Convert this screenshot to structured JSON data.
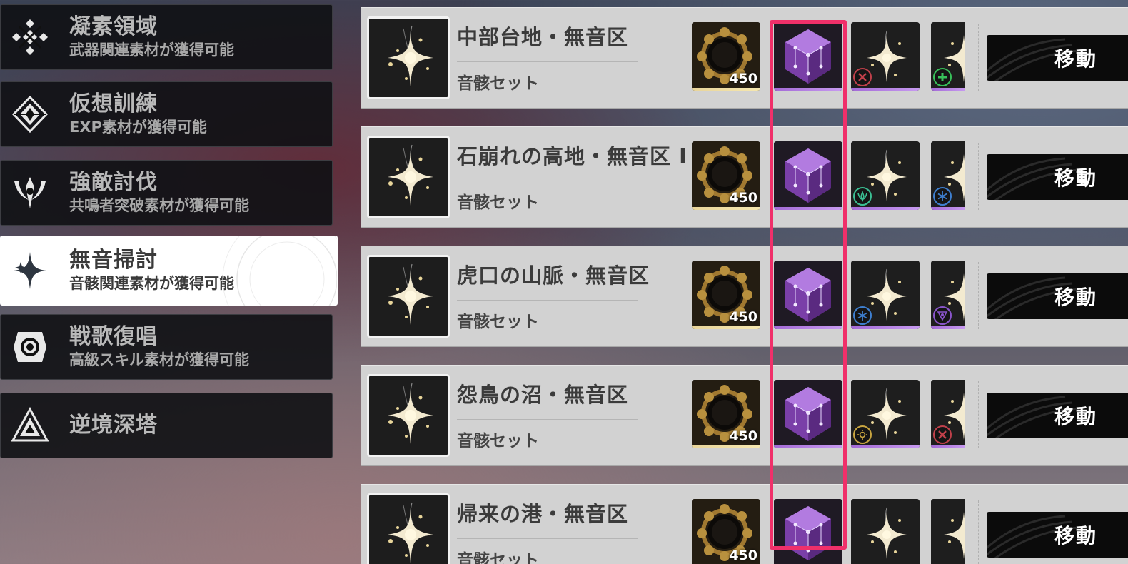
{
  "sidebar": {
    "items": [
      {
        "title": "凝素領域",
        "subtitle": "武器関連素材が獲得可能",
        "icon": "weapon-domain-icon",
        "active": false
      },
      {
        "title": "仮想訓練",
        "subtitle": "EXP素材が獲得可能",
        "icon": "simulation-training-icon",
        "active": false
      },
      {
        "title": "強敵討伐",
        "subtitle": "共鳴者突破素材が獲得可能",
        "icon": "boss-challenge-icon",
        "active": false
      },
      {
        "title": "無音掃討",
        "subtitle": "音骸関連素材が獲得可能",
        "icon": "sparkle-icon",
        "active": true
      },
      {
        "title": "戦歌復唱",
        "subtitle": "高級スキル素材が獲得可能",
        "icon": "weekly-challenge-icon",
        "active": false
      },
      {
        "title": "逆境深塔",
        "subtitle": "",
        "icon": "tower-icon",
        "active": false
      }
    ]
  },
  "rows": [
    {
      "region": "中部台地・無音区",
      "set_label": "音骸セット",
      "reward_qty": "450",
      "badge_a": {
        "icon": "crossed-swords-icon",
        "color": "#c0404a"
      },
      "badge_b": {
        "icon": "plus-icon",
        "color": "#38c15a"
      }
    },
    {
      "region": "石崩れの高地・無音区 I",
      "set_label": "音骸セット",
      "reward_qty": "450",
      "badge_a": {
        "icon": "wing-crest-icon",
        "color": "#3bbf93"
      },
      "badge_b": {
        "icon": "snowflake-icon",
        "color": "#3e7fd0"
      }
    },
    {
      "region": "虎口の山脈・無音区",
      "set_label": "音骸セット",
      "reward_qty": "450",
      "badge_a": {
        "icon": "snowflake-icon",
        "color": "#3e7fd0"
      },
      "badge_b": {
        "icon": "vortex-icon",
        "color": "#8a55cc"
      }
    },
    {
      "region": "怨鳥の沼・無音区",
      "set_label": "音骸セット",
      "reward_qty": "450",
      "badge_a": {
        "icon": "sun-icon",
        "color": "#c8a540"
      },
      "badge_b": {
        "icon": "crossed-swords-icon",
        "color": "#c0404a"
      }
    },
    {
      "region": "帰来の港・無音区",
      "set_label": "音骸セット",
      "reward_qty": "450",
      "badge_a": {
        "icon": "none",
        "color": ""
      },
      "badge_b": {
        "icon": "none",
        "color": ""
      }
    }
  ],
  "move_label": "移動",
  "colors": {
    "highlight": "#f0306a",
    "rarity_gold": "#e8d49a",
    "rarity_purple": "#a36ad6",
    "active_bg": "#ffffff"
  }
}
